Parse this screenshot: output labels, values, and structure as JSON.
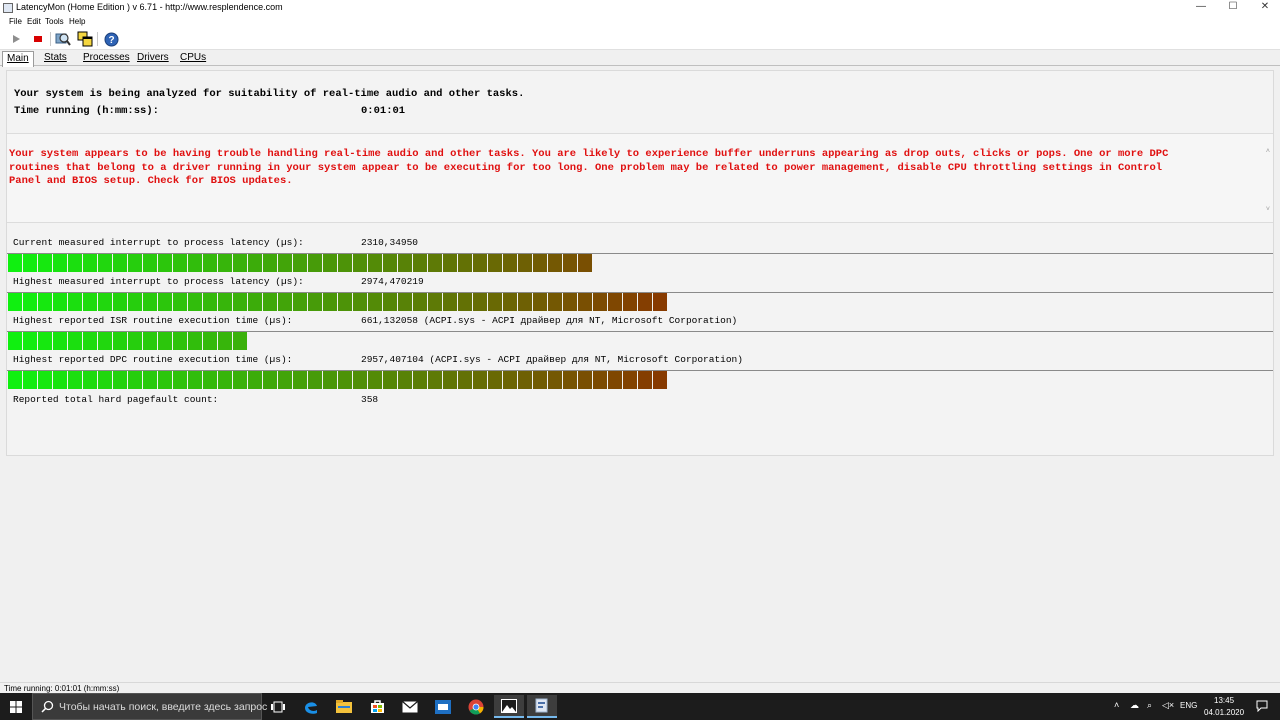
{
  "window": {
    "title": "LatencyMon  (Home Edition )  v 6.71 - http://www.resplendence.com",
    "min_glyph": "—",
    "max_glyph": "☐",
    "close_glyph": "✕"
  },
  "menu": {
    "file": "File",
    "edit": "Edit",
    "tools": "Tools",
    "help": "Help"
  },
  "toolbar": {
    "play_icon": "play-icon",
    "stop_icon": "stop-icon",
    "search_icon": "magnifier-icon",
    "windows_icon": "windows-icon",
    "help_icon": "help-icon"
  },
  "tabs": {
    "main": "Main",
    "stats": "Stats",
    "processes": "Processes",
    "drivers": "Drivers",
    "cpus": "CPUs"
  },
  "main": {
    "status_heading": "Your system is being analyzed for suitability of real-time audio and other tasks.",
    "time_label": "Time running (h:mm:ss):",
    "time_value": "0:01:01",
    "warning": "Your system appears to be having trouble handling real-time audio and other tasks. You are likely to experience buffer underruns appearing as drop outs, clicks or pops. One or more DPC\nroutines that belong to a driver running in your system appear to be executing for too long. One problem may be related to power management, disable CPU throttling settings in Control\nPanel and BIOS setup. Check for BIOS updates.",
    "scroll_up_glyph": "˄",
    "scroll_down_glyph": "˅",
    "metrics": [
      {
        "label": "Current measured interrupt to process latency (µs):",
        "value": "2310,34950",
        "bar_fraction": 0.463
      },
      {
        "label": "Highest measured interrupt to process latency (µs):",
        "value": "2974,470219",
        "bar_fraction": 0.519
      },
      {
        "label": "Highest reported ISR routine execution time (µs):",
        "value": "661,132058   (ACPI.sys - ACPI драйвер для NT, Microsoft Corporation)",
        "bar_fraction": 0.183
      },
      {
        "label": "Highest reported DPC routine execution time (µs):",
        "value": "2957,407104   (ACPI.sys - ACPI драйвер для NT, Microsoft Corporation)",
        "bar_fraction": 0.519
      }
    ],
    "pagefault_label": "Reported total hard pagefault count:",
    "pagefault_value": "358"
  },
  "statusbar": {
    "text": "Time running: 0:01:01  (h:mm:ss)"
  },
  "taskbar": {
    "search_placeholder": "Чтобы начать поиск, введите здесь запрос",
    "apps": [
      "task-view-icon",
      "edge-icon",
      "file-explorer-icon",
      "store-icon",
      "mail-icon",
      "weather-icon",
      "chrome-icon",
      "photos-icon",
      "latencymon-icon"
    ],
    "tray_chevron": "˄",
    "tray_icons": [
      "☁",
      "⌕",
      "◁×"
    ],
    "language": "ENG",
    "time": "13:45",
    "date": "04.01.2020"
  },
  "colors": {
    "warning_text": "#e01010",
    "bar_start": "#10f010",
    "bar_end": "#8a3600",
    "taskbar": "#1c1c1c"
  }
}
